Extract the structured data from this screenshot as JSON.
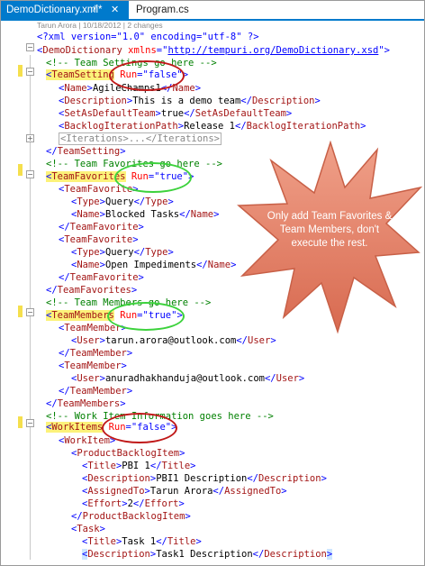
{
  "tabs": [
    {
      "label": "DemoDictionary.xml*",
      "active": true
    },
    {
      "label": "Program.cs",
      "active": false
    }
  ],
  "tab_pin_icon": "pin-icon",
  "tab_close_icon": "close-icon",
  "author_line": "Tarun Arora | 10/18/2012 | 2 changes",
  "code": {
    "xml_decl": "<?xml version=\"1.0\" encoding=\"utf-8\" ?>",
    "root_open_tag": "DemoDictionary",
    "root_attr": "xmlns",
    "root_ns": "http://tempuri.org/DemoDictionary.xsd",
    "comment_team_settings": "<!-- Team Settings go here -->",
    "teamsetting": "TeamSetting",
    "run_attr": "Run",
    "false_val": "\"false\"",
    "true_val": "\"true\"",
    "name_tag": "Name",
    "name_value": "AgileChamps1",
    "description_tag": "Description",
    "description_value": "This is a demo team",
    "setasdefault_tag": "SetAsDefaultTeam",
    "setasdefault_value": "true",
    "backlog_tag": "BacklogIterationPath",
    "backlog_value": "Release 1",
    "iterations_collapsed": "<Iterations>...</Iterations>",
    "comment_team_favorites": "<!-- Team Favorites go here -->",
    "teamfavorites": "TeamFavorites",
    "teamfavorite": "TeamFavorite",
    "type_tag": "Type",
    "query_value": "Query",
    "fav1_name": "Blocked Tasks",
    "fav2_name": "Open Impediments",
    "comment_team_members": "<!-- Team Members go here -->",
    "teammembers": "TeamMembers",
    "teammember": "TeamMember",
    "user_tag": "User",
    "user1": "tarun.arora@outlook.com",
    "user2": "anuradhakhanduja@outlook.com",
    "comment_work_items": "<!-- Work Item Information goes here -->",
    "workitems": "WorkItems",
    "workitem": "WorkItem",
    "pbi_tag": "ProductBacklogItem",
    "title_tag": "Title",
    "pbi_title": "PBI 1",
    "pbi_description": "PBI1 Description",
    "assigned_tag": "AssignedTo",
    "assigned_value": "Tarun Arora",
    "effort_tag": "Effort",
    "effort_value": "2",
    "task_tag": "Task",
    "task_title": "Task 1",
    "task_description": "Task1 Description"
  },
  "callout_text": "Only add Team Favorites & Team Members, don't execute the rest.",
  "colors": {
    "tab_active": "#007acc",
    "tag": "#a31515",
    "attribute": "#ff0000",
    "bracket": "#0000ff",
    "comment": "#008000",
    "highlight": "#fcf27a",
    "callout_fill": "#e2836c",
    "red_oval": "#c01818",
    "green_oval": "#3cd23c"
  }
}
